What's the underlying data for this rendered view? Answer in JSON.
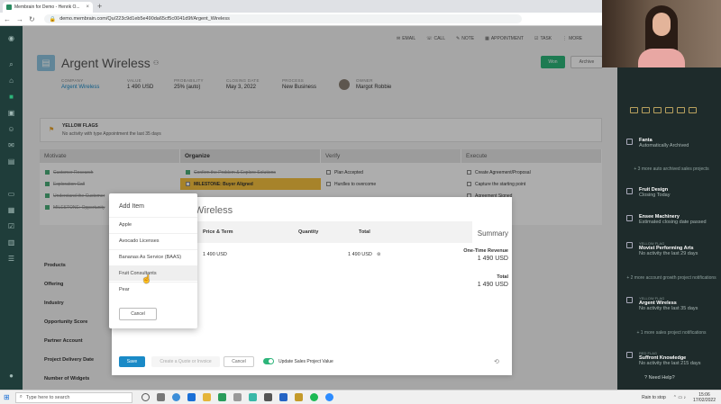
{
  "browser": {
    "tab_title": "Membrain for Demo - Henrik O...",
    "url": "demo.membrain.com/Qu/223c9d1eb5e490da65cf5c0041d9f/Argent_Wireless"
  },
  "top_actions": [
    {
      "icon": "mail-icon",
      "label": "EMAIL"
    },
    {
      "icon": "phone-icon",
      "label": "CALL"
    },
    {
      "icon": "note-icon",
      "label": "NOTE"
    },
    {
      "icon": "calendar-icon",
      "label": "APPOINTMENT"
    },
    {
      "icon": "task-icon",
      "label": "TASK"
    },
    {
      "icon": "more-icon",
      "label": "MORE"
    }
  ],
  "deal": {
    "title": "Argent Wireless",
    "won_label": "Won",
    "archive_label": "Archive",
    "meta": [
      {
        "label": "COMPANY",
        "value": "Argent Wireless"
      },
      {
        "label": "VALUE",
        "value": "1 490 USD"
      },
      {
        "label": "PROBABILITY",
        "value": "25% (auto)"
      },
      {
        "label": "CLOSING DATE",
        "value": "May 3, 2022"
      },
      {
        "label": "PROCESS",
        "value": "New Business"
      },
      {
        "label": "OWNER",
        "value": "Margot Robbie"
      }
    ]
  },
  "yellow_flags": {
    "title": "YELLOW FLAGS",
    "text": "No activity with type Appointment the last 35 days"
  },
  "stages": [
    {
      "name": "Motivate",
      "tasks": [
        {
          "text": "Customer Research",
          "done": true
        },
        {
          "text": "Exploration Call",
          "done": true
        },
        {
          "text": "Understand the Customer",
          "done": true
        },
        {
          "text": "MILESTONE: Opportunity",
          "done": true
        }
      ]
    },
    {
      "name": "Organize",
      "tasks": [
        {
          "text": "Confirm the Problem & Explore Solutions",
          "done": true
        },
        {
          "text": "MILESTONE: Buyer Aligned",
          "done": false
        }
      ]
    },
    {
      "name": "Verify",
      "tasks": [
        {
          "text": "Plan Accepted",
          "done": false
        },
        {
          "text": "Hurdles to overcome",
          "done": false
        }
      ]
    },
    {
      "name": "Execute",
      "tasks": [
        {
          "text": "Create Agreement/Proposal",
          "done": false
        },
        {
          "text": "Capture the starting point",
          "done": false
        },
        {
          "text": "Agreement Signed",
          "done": false
        }
      ]
    }
  ],
  "field_labels": [
    "Products",
    "Offering",
    "Industry",
    "Opportunity Score",
    "Partner Account",
    "Project Delivery Date",
    "Number of Widgets"
  ],
  "modal": {
    "title": "Wireless",
    "col_price": "Price & Term",
    "col_qty": "Quantity",
    "col_total": "Total",
    "row_price": "1 490 USD",
    "row_total": "1 490 USD",
    "summary_title": "Summary",
    "one_time_label": "One-Time Revenue",
    "one_time_value": "1 490 USD",
    "total_label": "Total",
    "total_value": "1 490 USD",
    "save": "Save",
    "quote": "Create a Quote or Invoice",
    "cancel": "Cancel",
    "toggle_label": "Update Sales Project Value"
  },
  "add_item": {
    "title": "Add Item",
    "items": [
      "Apple",
      "Avocado Licenses",
      "Bananas As Service (BAAS)",
      "Fruit Consultants",
      "Pear"
    ],
    "cancel": "Cancel"
  },
  "right_panel": {
    "items": [
      {
        "title": "Fanta",
        "desc": "Automatically Archived"
      },
      {
        "more": "+ 3 more auto archived sales projects"
      },
      {
        "title": "Fruit Design",
        "desc": "Closing Today"
      },
      {
        "title": "Ensee Machinery",
        "desc": "Estimated closing date passed"
      },
      {
        "tag": "YELLOW FLAG",
        "title": "Movist Performing Arts",
        "desc": "No activity the last 29 days"
      },
      {
        "more": "+ 2 more account growth project notifications"
      },
      {
        "tag": "YELLOW FLAG",
        "title": "Argent Wireless",
        "desc": "No activity the last 35 days"
      },
      {
        "more": "+ 1 more sales project notifications"
      },
      {
        "tag": "RED FLAG",
        "title": "Suffront Knowledge",
        "desc": "No activity the last 215 days"
      }
    ],
    "help": "Need Help?"
  },
  "taskbar": {
    "search": "Type here to search",
    "weather": "Rain to stop",
    "time": "15:06",
    "date": "17/02/2022"
  },
  "colors": {
    "accent": "#2db57a",
    "nav": "#1f3d3a",
    "link": "#1a8ac7",
    "milestone": "#f6c23e"
  }
}
